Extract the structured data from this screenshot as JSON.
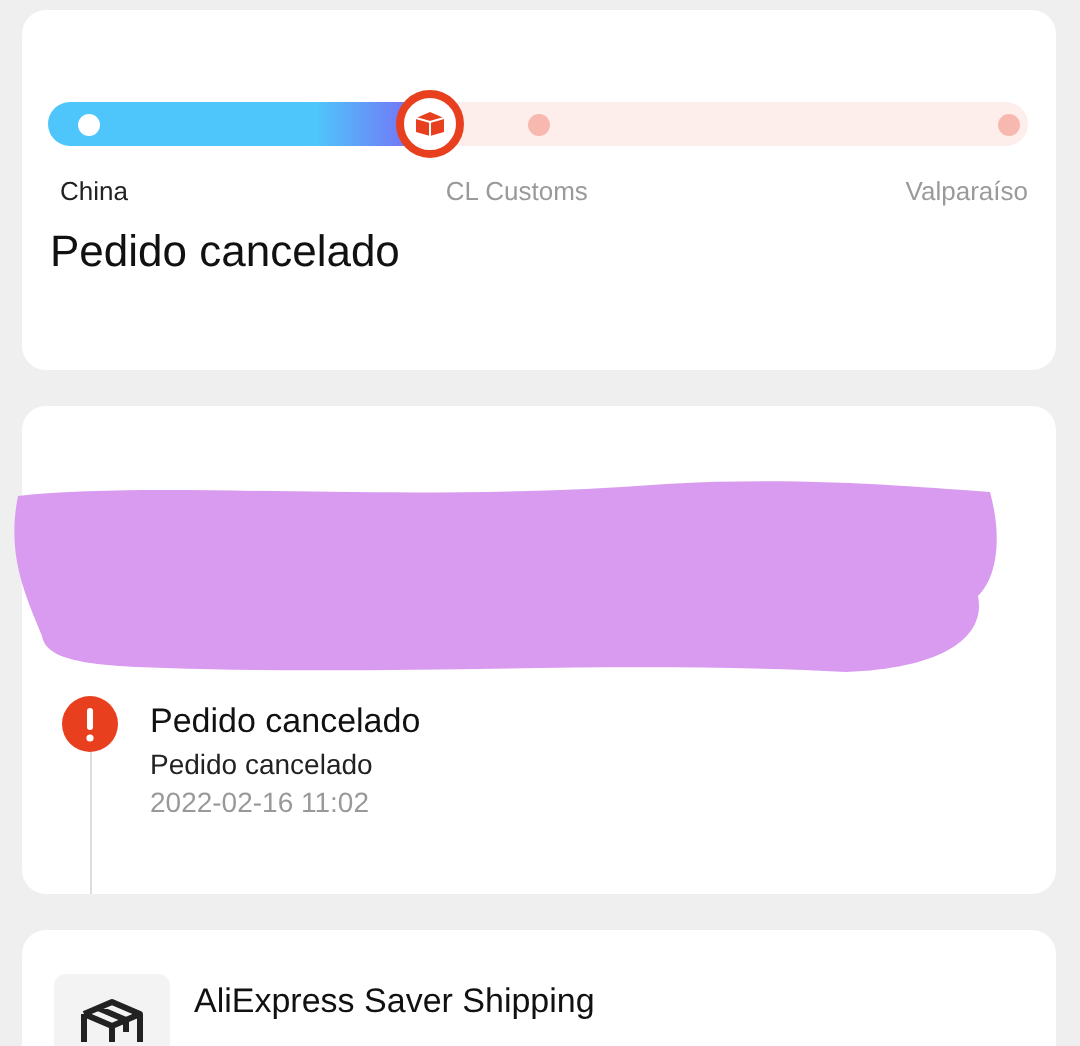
{
  "tracking": {
    "level": 0.39,
    "stops": [
      {
        "label": "China",
        "reached": true
      },
      {
        "label": "CL Customs",
        "reached": false
      },
      {
        "label": "Valparaíso",
        "reached": false
      }
    ],
    "status": "Pedido cancelado"
  },
  "events": [
    {
      "kind": "error",
      "title": "Pedido cancelado",
      "detail": "Pedido cancelado",
      "time": "2022-02-16 11:02"
    }
  ],
  "shipping": {
    "method": "AliExpress Saver Shipping"
  }
}
